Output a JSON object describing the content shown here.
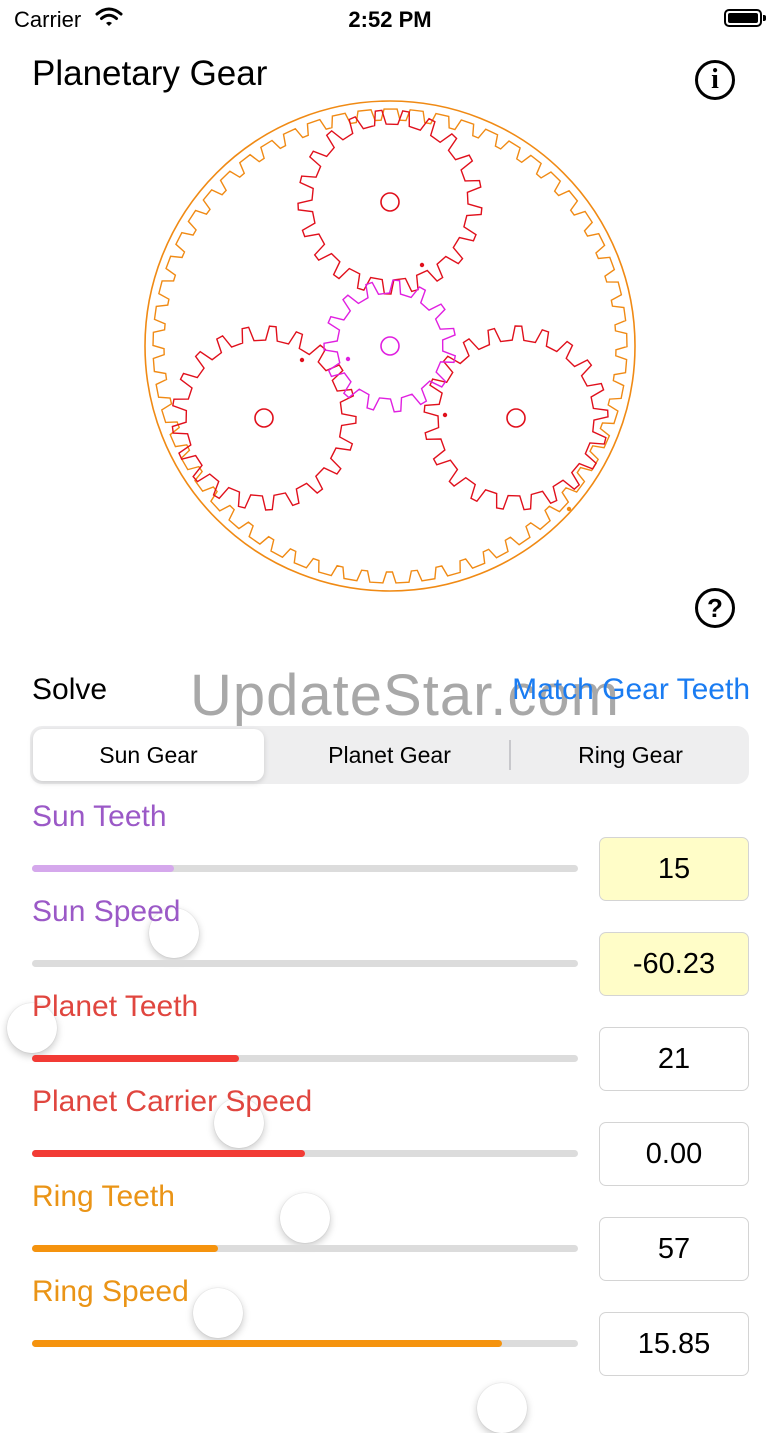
{
  "status": {
    "carrier": "Carrier",
    "time": "2:52 PM"
  },
  "header": {
    "title": "Planetary Gear"
  },
  "icons": {
    "info": "info-circle-icon",
    "help": "question-circle-icon"
  },
  "gear_view": {
    "sun_color": "#e020e0",
    "planet_color": "#e0101c",
    "ring_color": "#f08a14",
    "sun_teeth": 15,
    "planet_teeth": 21,
    "ring_teeth": 57
  },
  "solve": {
    "label": "Solve",
    "match_link": "Match Gear Teeth"
  },
  "watermark": "UpdateStar.com",
  "segments": [
    {
      "label": "Sun Gear",
      "selected": true
    },
    {
      "label": "Planet Gear",
      "selected": false
    },
    {
      "label": "Ring Gear",
      "selected": false
    }
  ],
  "controls": [
    {
      "label": "Sun Teeth",
      "value": "15",
      "color": "#9b59c7",
      "fill_color": "#d5a8ec",
      "level": 0.26,
      "highlighted": true
    },
    {
      "label": "Sun Speed",
      "value": "-60.23",
      "color": "#9b59c7",
      "fill_color": "#d5a8ec",
      "level": 0.0,
      "highlighted": true
    },
    {
      "label": "Planet Teeth",
      "value": "21",
      "color": "#e0463f",
      "fill_color": "#f23b35",
      "level": 0.38,
      "highlighted": false
    },
    {
      "label": "Planet Carrier Speed",
      "value": "0.00",
      "color": "#e0463f",
      "fill_color": "#f23b35",
      "level": 0.5,
      "highlighted": false
    },
    {
      "label": "Ring Teeth",
      "value": "57",
      "color": "#ea9416",
      "fill_color": "#f5930e",
      "level": 0.34,
      "highlighted": false
    },
    {
      "label": "Ring Speed",
      "value": "15.85",
      "color": "#ea9416",
      "fill_color": "#f5930e",
      "level": 0.86,
      "highlighted": false
    }
  ]
}
